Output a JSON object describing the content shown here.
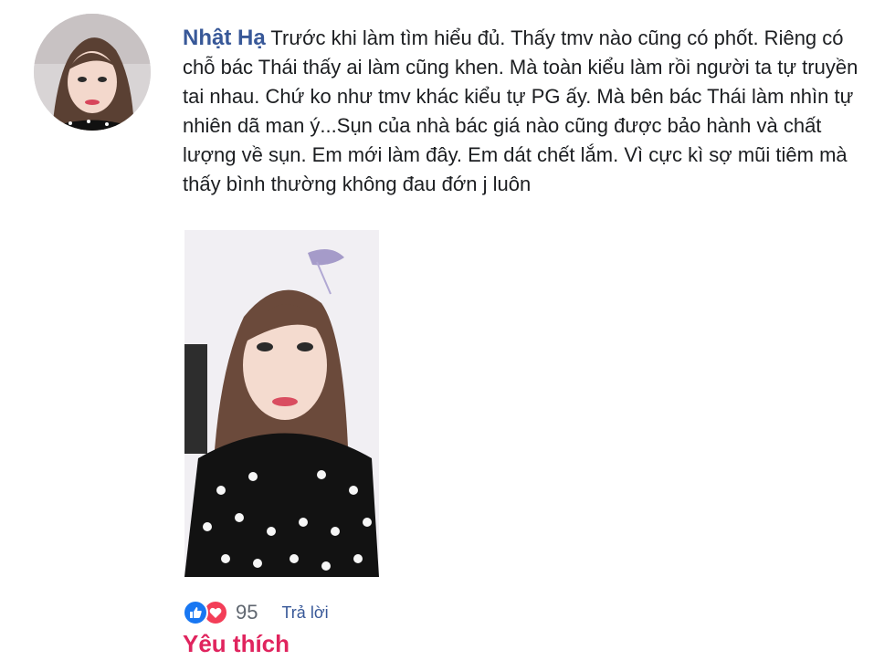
{
  "comment": {
    "author": "Nhật Hạ",
    "text": "Trước khi làm tìm hiểu đủ. Thấy tmv nào cũng có phốt. Riêng có chỗ bác Thái thấy ai làm cũng khen. Mà toàn kiểu làm rồi người ta tự truyền tai nhau. Chứ ko như tmv khác kiểu tự PG ấy. Mà bên bác Thái làm nhìn tự nhiên dã man ý...Sụn của nhà bác giá nào cũng được bảo hành và chất lượng về sụn. Em mới làm đây. Em dát chết lắm. Vì cực kì sợ mũi tiêm mà thấy bình thường không đau đớn j luôn"
  },
  "actions": {
    "reaction_count": "95",
    "reply_label": "Trả lời"
  },
  "status": {
    "label": "Yêu thích"
  },
  "colors": {
    "author": "#385898",
    "like": "#1877f2",
    "love": "#f33e58",
    "favorite": "#e0245e"
  },
  "icons": {
    "like": "like-icon",
    "love": "heart-icon"
  }
}
